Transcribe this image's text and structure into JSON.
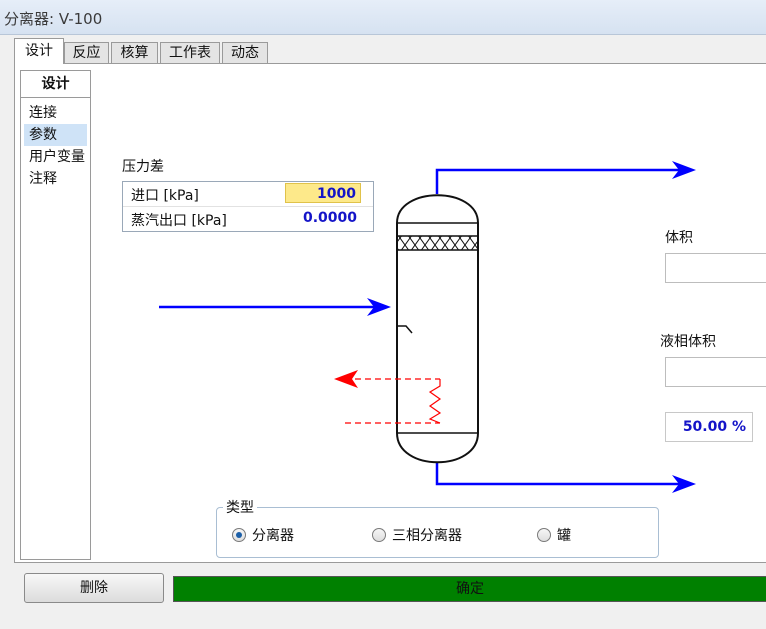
{
  "window": {
    "title": "分离器: V-100"
  },
  "tabs": [
    {
      "label": "设计"
    },
    {
      "label": "反应"
    },
    {
      "label": "核算"
    },
    {
      "label": "工作表"
    },
    {
      "label": "动态"
    }
  ],
  "nav": {
    "header": "设计",
    "items": [
      {
        "label": "连接"
      },
      {
        "label": "参数"
      },
      {
        "label": "用户变量"
      },
      {
        "label": "注释"
      }
    ]
  },
  "pressure_drop": {
    "label": "压力差",
    "rows": [
      {
        "label": "进口 [kPa]",
        "value": "1000"
      },
      {
        "label": "蒸汽出口 [kPa]",
        "value": "0.0000"
      }
    ]
  },
  "volume": {
    "label": "体积"
  },
  "liquid_volume": {
    "label": "液相体积",
    "percent": "50.00 %"
  },
  "vessel_type": {
    "label": "类型",
    "options": [
      {
        "label": "分离器",
        "selected": true
      },
      {
        "label": "三相分离器",
        "selected": false
      },
      {
        "label": "罐",
        "selected": false
      }
    ]
  },
  "buttons": {
    "delete": "删除",
    "ok": "确定"
  },
  "colors": {
    "stream_blue": "#0000ff",
    "energy_red": "#ff0000",
    "ok_green": "#008000",
    "value_blue": "#1414c8",
    "highlight_yellow": "#fde98a"
  }
}
